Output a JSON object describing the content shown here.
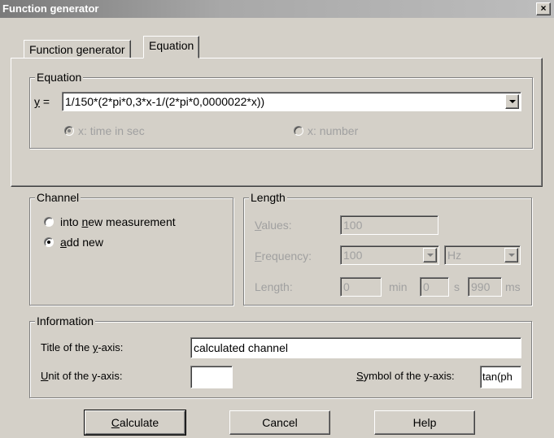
{
  "window": {
    "title": "Function generator",
    "close_label": "×"
  },
  "tabs": [
    {
      "label": "Function generator"
    },
    {
      "label": "Equation"
    }
  ],
  "equation": {
    "group_label": "Equation",
    "y_label_accel": "y",
    "y_label_rest": " =",
    "value": "1/150*(2*pi*0,3*x-1/(2*pi*0,0000022*x))",
    "opt_time": "x: time in sec",
    "opt_number": "x: number"
  },
  "channel": {
    "group_label": "Channel",
    "opt_new_pre": "into ",
    "opt_new_accel": "n",
    "opt_new_post": "ew measurement",
    "opt_add_accel": "a",
    "opt_add_post": "dd new"
  },
  "length": {
    "group_label": "Length",
    "values_accel": "V",
    "values_rest": "alues:",
    "values_value": "100",
    "freq_accel": "F",
    "freq_rest": "requency:",
    "freq_value": "100",
    "freq_unit": "Hz",
    "length_label": "Length:",
    "min_value": "0",
    "min_unit": "min",
    "s_value": "0",
    "s_unit": "s",
    "ms_value": "990",
    "ms_unit": "ms"
  },
  "information": {
    "group_label": "Information",
    "title_pre": "Title of the ",
    "title_accel": "y",
    "title_post": "-axis:",
    "title_value": "calculated channel",
    "unit_accel": "U",
    "unit_rest": "nit of the y-axis:",
    "unit_value": "",
    "symbol_accel": "S",
    "symbol_rest": "ymbol of the y-axis:",
    "symbol_value": "tan(ph"
  },
  "buttons": {
    "calculate_accel": "C",
    "calculate_rest": "alculate",
    "cancel": "Cancel",
    "help": "Help"
  }
}
